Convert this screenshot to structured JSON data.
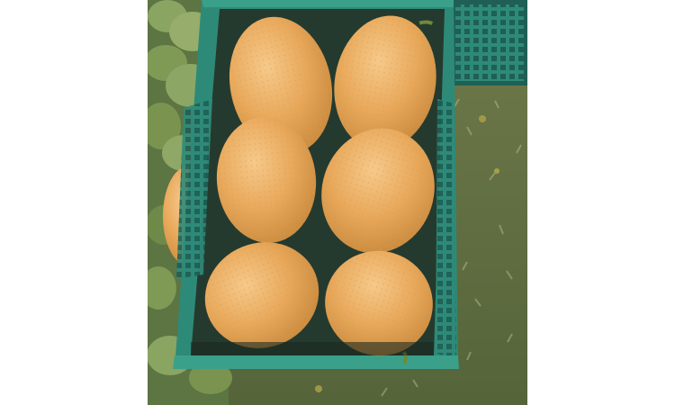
{
  "photo": {
    "subject": "melons-in-crate",
    "melon_count": 7,
    "colors": {
      "background": "#ffffff",
      "crate": "#2e8a78",
      "crate_dark": "#1f5f55",
      "melon": "#e8a85a",
      "melon_shade": "#c98a3e",
      "grass": "#6f7a4a",
      "leaf": "#7f9a55"
    }
  }
}
